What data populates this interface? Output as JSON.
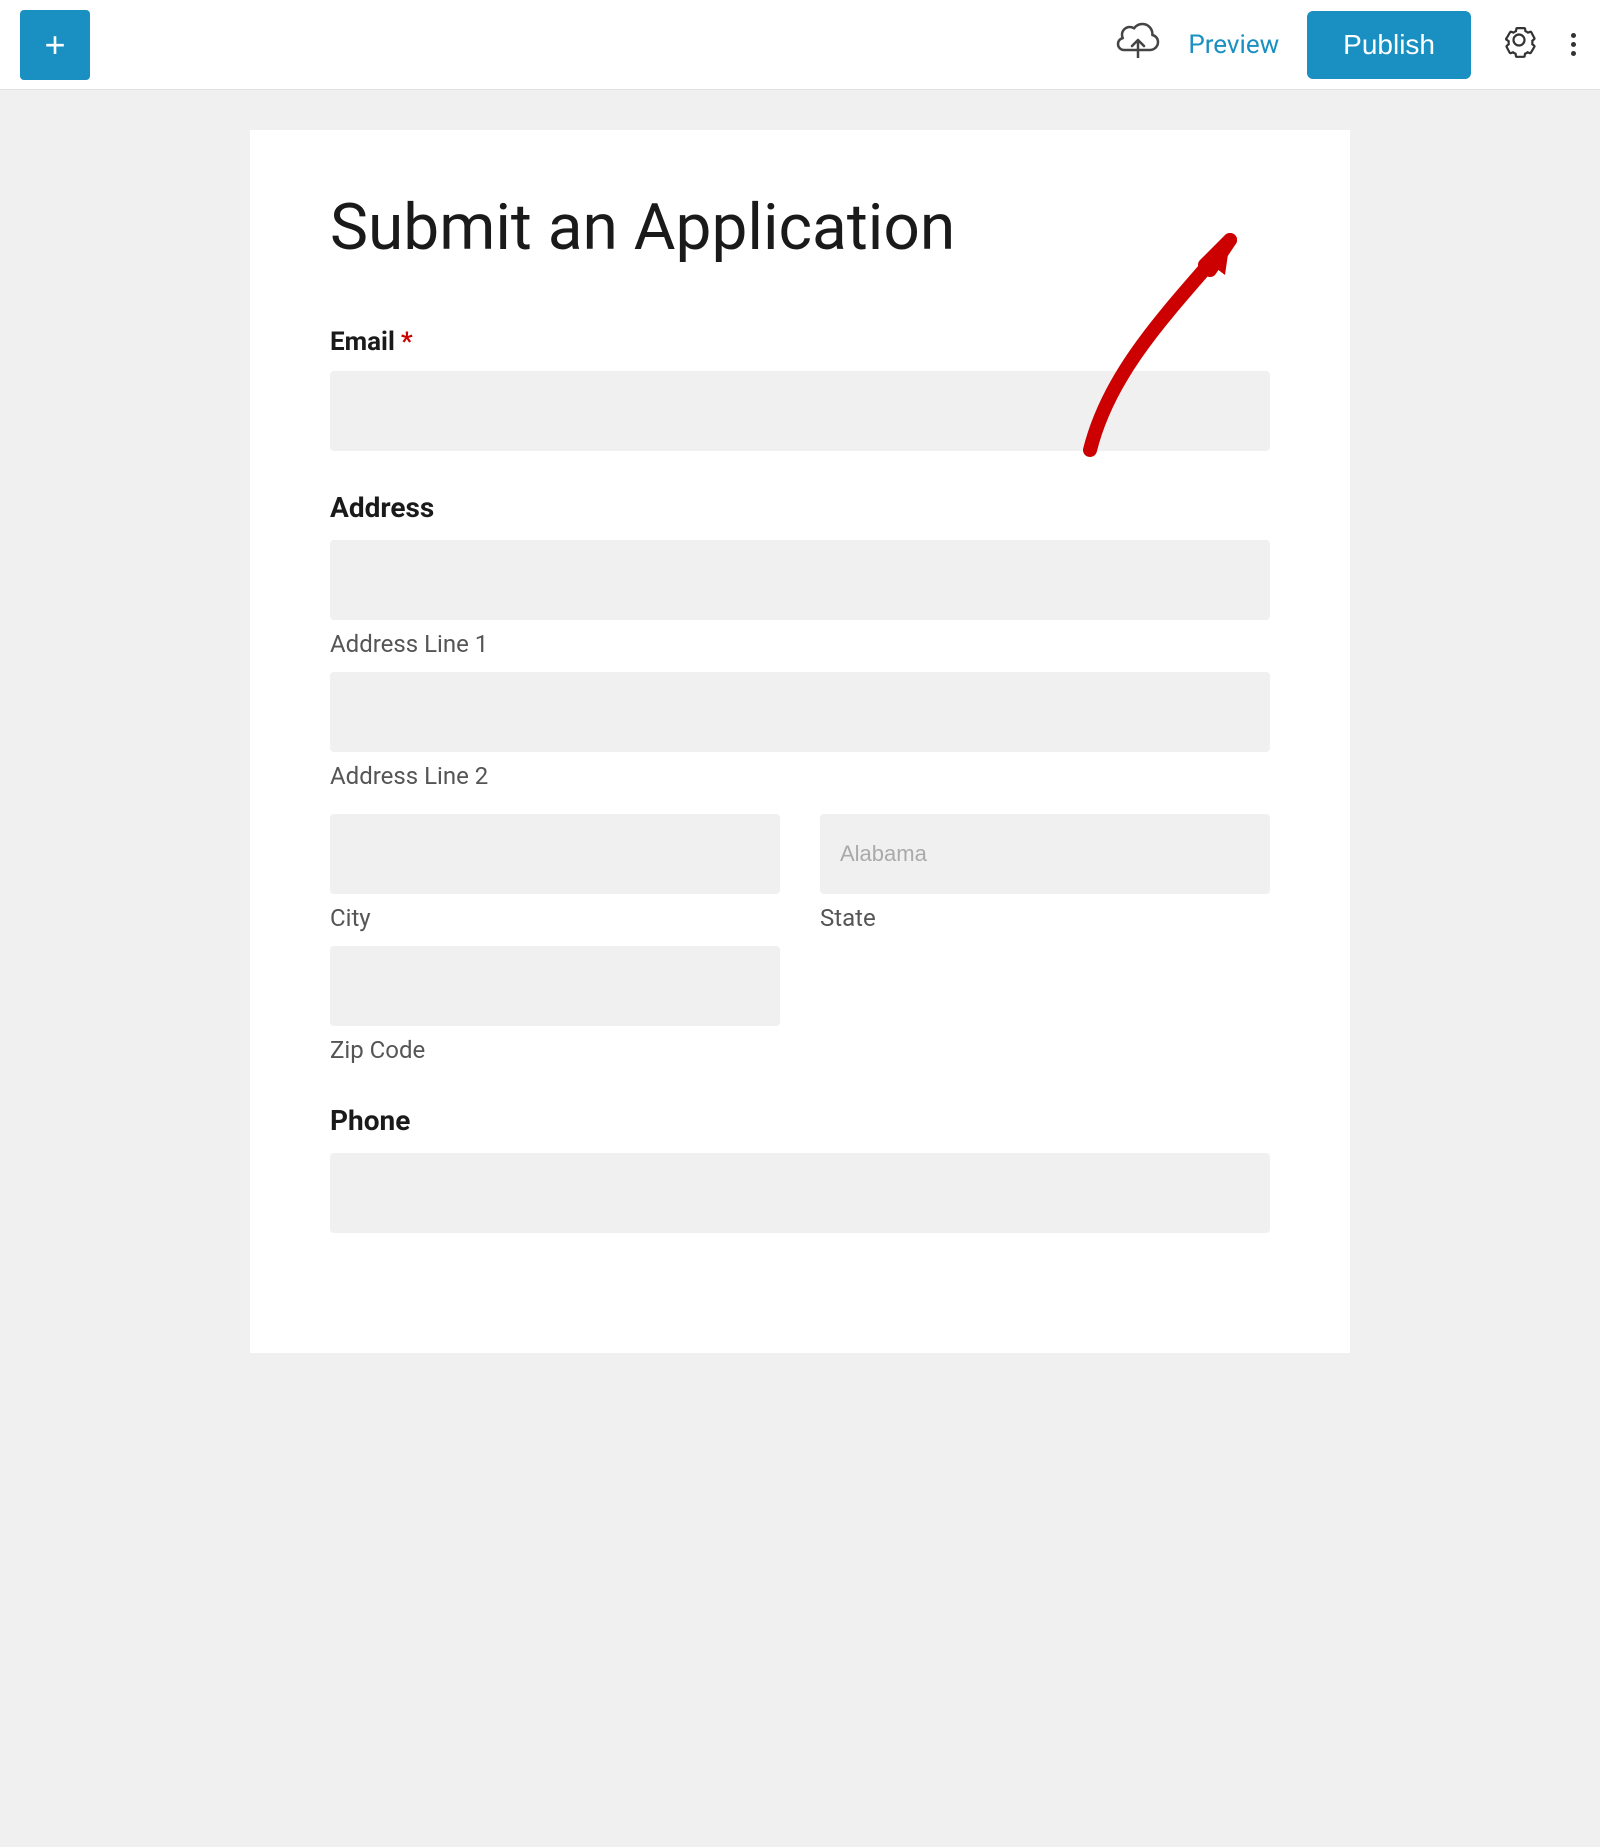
{
  "toolbar": {
    "add_icon": "+",
    "cloud_icon": "⬆",
    "preview_label": "Preview",
    "publish_label": "Publish",
    "gear_icon": "⚙",
    "more_icon": "⋮",
    "colors": {
      "primary": "#1a8fc1",
      "toolbar_bg": "#ffffff"
    }
  },
  "form": {
    "title": "Submit an Application",
    "fields": {
      "email": {
        "label": "Email",
        "required": true,
        "required_marker": "*",
        "placeholder": ""
      },
      "address": {
        "section_label": "Address",
        "line1_placeholder": "",
        "line1_sub_label": "Address Line 1",
        "line2_placeholder": "",
        "line2_sub_label": "Address Line 2",
        "city_placeholder": "",
        "city_sub_label": "City",
        "state_placeholder": "Alabama",
        "state_sub_label": "State",
        "zip_placeholder": "",
        "zip_sub_label": "Zip Code"
      },
      "phone": {
        "section_label": "Phone",
        "placeholder": ""
      }
    }
  }
}
